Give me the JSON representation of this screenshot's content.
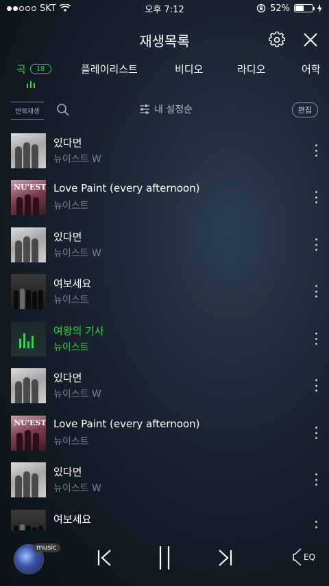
{
  "status_bar": {
    "carrier": "SKT",
    "time": "오후 7:12",
    "battery_percent": "52%",
    "battery_level": 0.52,
    "signal_filled_dots": 2,
    "signal_total_dots": 5
  },
  "header": {
    "title": "재생목록"
  },
  "tabs": [
    {
      "label": "곡",
      "count": "18",
      "active": true
    },
    {
      "label": "플레이리스트"
    },
    {
      "label": "비디오"
    },
    {
      "label": "라디오"
    },
    {
      "label": "어학"
    }
  ],
  "toolbar": {
    "repeat_label": "반복재생",
    "sort_label": "내 설정순",
    "edit_label": "편집"
  },
  "songs": [
    {
      "title": "있다면",
      "artist": "뉴이스트 W",
      "playing": false
    },
    {
      "title": "Love Paint (every afternoon)",
      "artist": "뉴이스트",
      "playing": false
    },
    {
      "title": "있다면",
      "artist": "뉴이스트 W",
      "playing": false
    },
    {
      "title": "여보세요",
      "artist": "뉴이스트",
      "playing": false
    },
    {
      "title": "여왕의 기사",
      "artist": "뉴이스트",
      "playing": true
    },
    {
      "title": "있다면",
      "artist": "뉴이스트 W",
      "playing": false
    },
    {
      "title": "Love Paint (every afternoon)",
      "artist": "뉴이스트",
      "playing": false
    },
    {
      "title": "있다면",
      "artist": "뉴이스트 W",
      "playing": false
    },
    {
      "title": "여보세요",
      "artist": "",
      "playing": false
    }
  ],
  "album_art_text": {
    "nuest_logo": "NU'EST"
  },
  "player": {
    "source_badge": "music",
    "eq_label": "EQ"
  },
  "colors": {
    "accent": "#2bdc3c",
    "muted_text": "#7a808a"
  }
}
